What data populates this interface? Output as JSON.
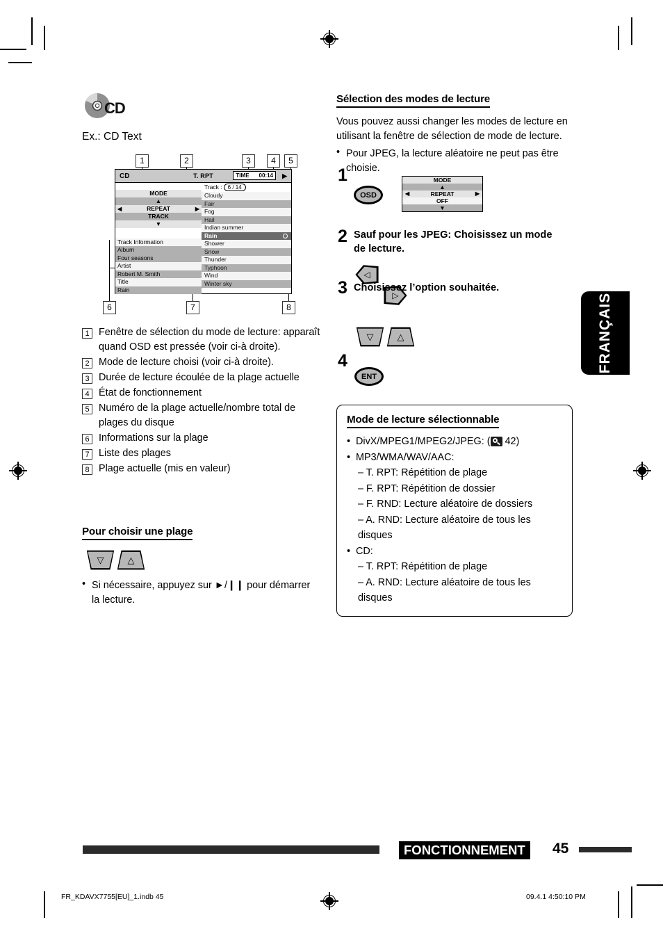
{
  "page": {
    "number": "45",
    "footer_section": "FONCTIONNEMENT",
    "language_tab": "FRANÇAIS",
    "indb_file": "FR_KDAVX7755[EU]_1.indb   45",
    "timestamp": "09.4.1   4:50:10 PM"
  },
  "left_column": {
    "media_badge": "CD",
    "example_caption": "Ex.: CD Text",
    "screen": {
      "status_bar": {
        "source": "CD",
        "play_mode": "T. RPT",
        "time_label": "TIME",
        "time_value": "00:14",
        "play_icon": "play-icon"
      },
      "mode_window": {
        "title": "MODE",
        "up_arrow": "▲",
        "left_arrow": "◀",
        "item": "REPEAT",
        "right_arrow": "▶",
        "value": "TRACK",
        "down_arrow": "▼"
      },
      "track_information": {
        "header": "Track Information",
        "rows": [
          {
            "label": "Album",
            "value": "Four seasons"
          },
          {
            "label": "Artist",
            "value": "Robert M. Smith"
          },
          {
            "label": "Title",
            "value": "Rain"
          }
        ]
      },
      "track_list": {
        "label": "Track :",
        "counter": "6 / 14",
        "items": [
          "Cloudy",
          "Fair",
          "Fog",
          "Hail",
          "Indian summer",
          "Rain",
          "Shower",
          "Snow",
          "Thunder",
          "Typhoon",
          "Wind",
          "Winter sky"
        ],
        "selected": "Rain"
      }
    },
    "callout_tags": [
      "1",
      "2",
      "3",
      "4",
      "5",
      "6",
      "7",
      "8"
    ],
    "callouts": [
      {
        "num": "1",
        "text": "Fenêtre de sélection du mode de lecture: apparaît quand OSD est pressée (voir ci-à droite)."
      },
      {
        "num": "2",
        "text": "Mode de lecture choisi (voir ci-à droite)."
      },
      {
        "num": "3",
        "text": "Durée de lecture écoulée de la plage actuelle"
      },
      {
        "num": "4",
        "text": "État de fonctionnement"
      },
      {
        "num": "5",
        "text": "Numéro de la plage actuelle/nombre total de plages du disque"
      },
      {
        "num": "6",
        "text": "Informations sur la plage"
      },
      {
        "num": "7",
        "text": "Liste des plages"
      },
      {
        "num": "8",
        "text": "Plage actuelle (mis en valeur)"
      }
    ],
    "select_track": {
      "heading": "Pour choisir une plage",
      "key_down": "▽",
      "key_up": "△",
      "note": "Si nécessaire, appuyez sur ►/❙❙ pour démarrer la lecture."
    }
  },
  "right_column": {
    "heading": "Sélection des modes de lecture",
    "intro_line1": "Vous pouvez aussi changer les modes de lecture en",
    "intro_line2": "utilisant la fenêtre de sélection de mode de lecture.",
    "bullet": "Pour JPEG, la lecture aléatoire ne peut pas être choisie.",
    "steps": [
      {
        "num": "1",
        "text": "",
        "key": "OSD"
      },
      {
        "num": "2",
        "text": "Sauf pour les JPEG: Choisissez un mode de lecture.",
        "key_left": "◁",
        "key_right": "▷"
      },
      {
        "num": "3",
        "text": "Choisissez l’option souhaitée.",
        "key_down": "▽",
        "key_up": "△"
      },
      {
        "num": "4",
        "text": "",
        "key": "ENT"
      }
    ],
    "popup": {
      "title": "MODE",
      "up_arrow": "▲",
      "left_arrow": "◀",
      "item": "REPEAT",
      "right_arrow": "▶",
      "value": "OFF",
      "down_arrow": "▼"
    },
    "note_box": {
      "heading": "Mode de lecture sélectionnable",
      "items": [
        {
          "type": "bullet",
          "text": "DivX/MPEG1/MPEG2/JPEG: (",
          "ref_page": "42)",
          "has_ref_icon": true
        },
        {
          "type": "bullet",
          "text": "MP3/WMA/WAV/AAC:"
        },
        {
          "type": "dash",
          "text": "– T. RPT: Répétition de plage"
        },
        {
          "type": "dash",
          "text": "– F. RPT: Répétition de dossier"
        },
        {
          "type": "dash",
          "text": "– F. RND: Lecture aléatoire de dossiers"
        },
        {
          "type": "dash",
          "text": "– A. RND: Lecture aléatoire de tous les disques"
        },
        {
          "type": "bullet",
          "text": "CD:"
        },
        {
          "type": "dash",
          "text": "– T. RPT: Répétition de plage"
        },
        {
          "type": "dash",
          "text": "– A. RND: Lecture aléatoire de tous les disques"
        }
      ]
    }
  }
}
